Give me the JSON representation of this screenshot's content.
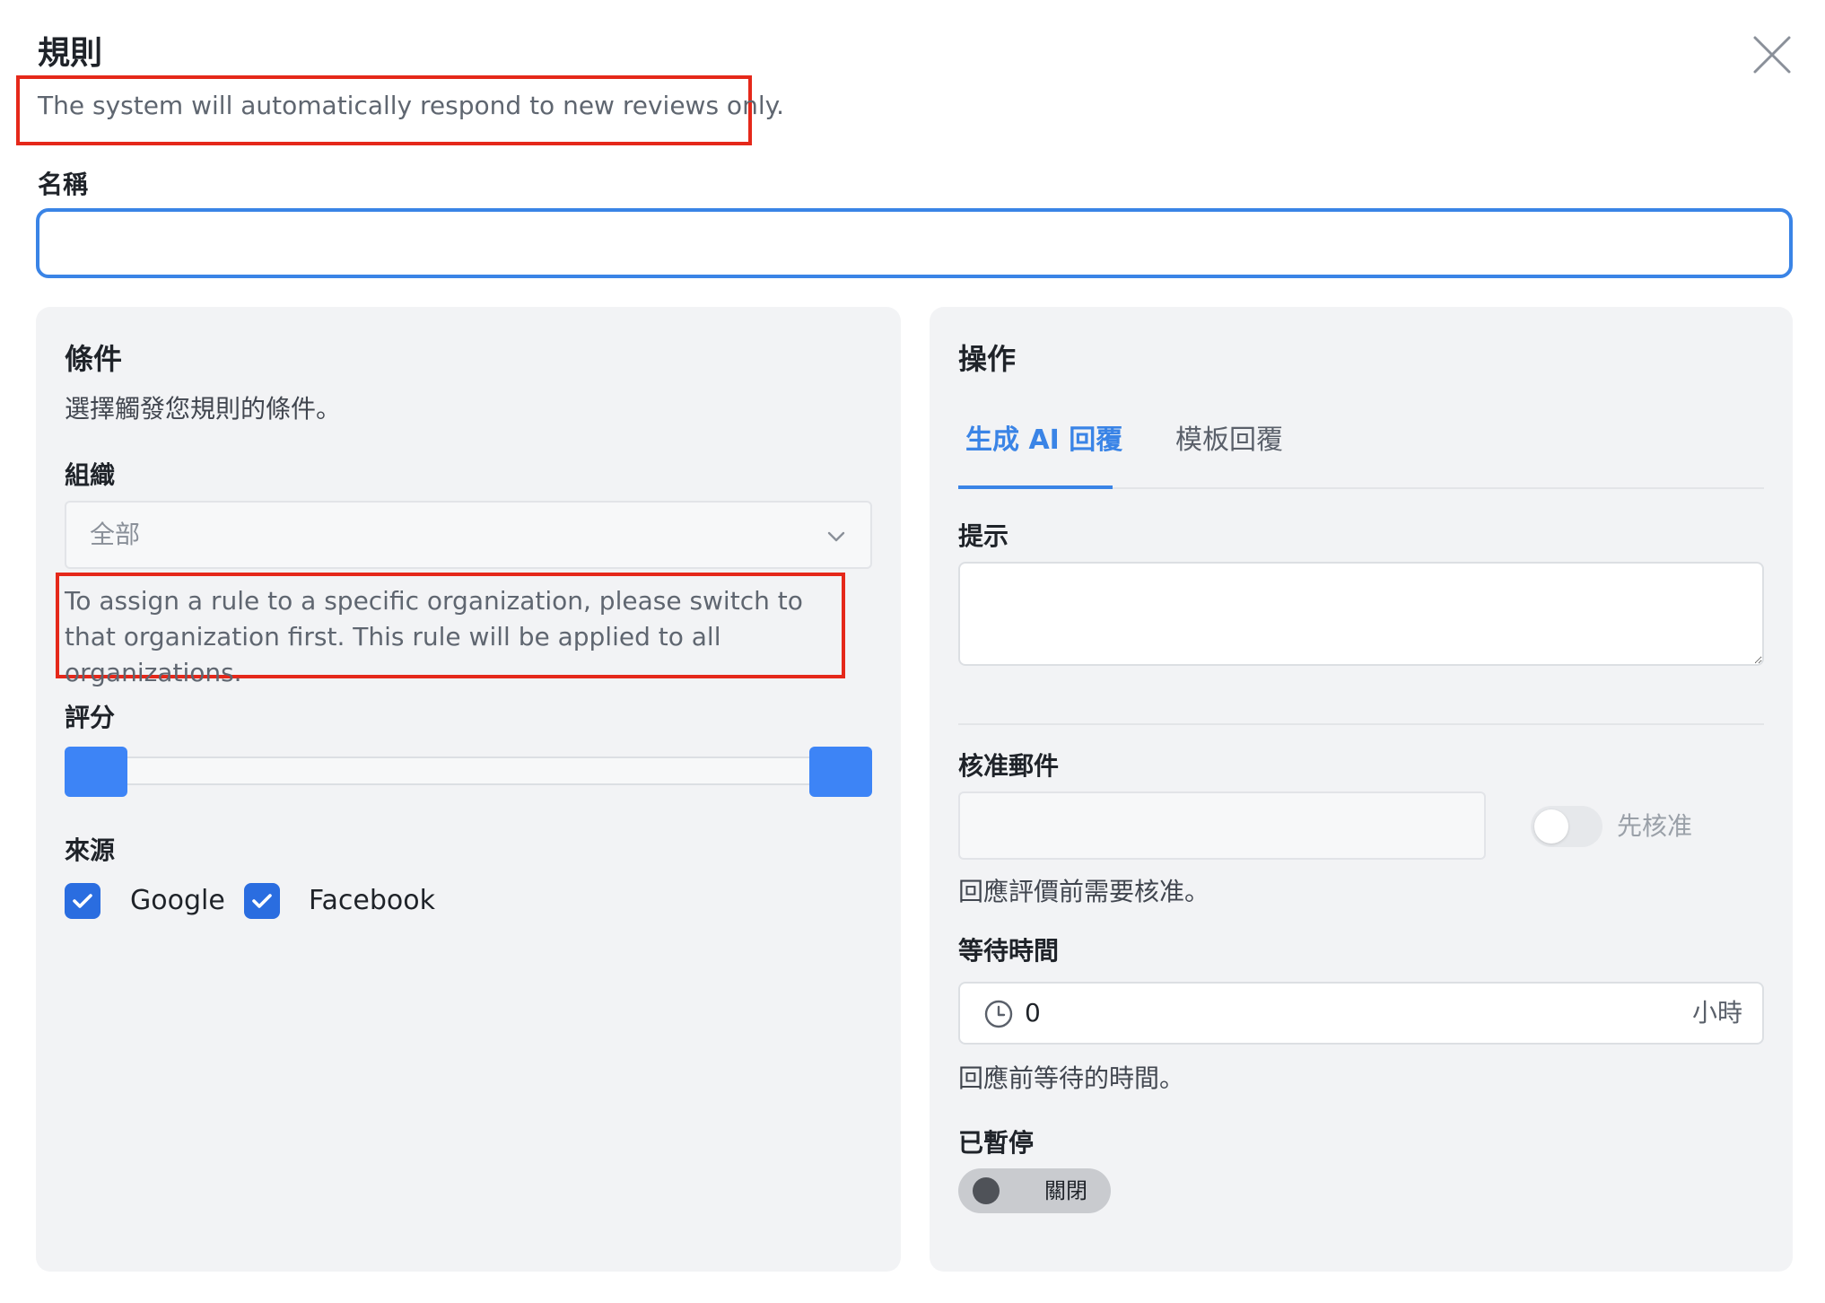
{
  "dialog": {
    "title": "規則",
    "subtitle": "The system will automatically respond to new reviews only."
  },
  "name_field": {
    "label": "名稱",
    "value": "",
    "placeholder": ""
  },
  "conditions": {
    "title": "條件",
    "description": "選擇觸發您規則的條件。",
    "organization": {
      "label": "組織",
      "selected": "全部",
      "note": "To assign a rule to a specific organization, please switch to that organization first. This rule will be applied to all organizations."
    },
    "rating": {
      "label": "評分"
    },
    "source": {
      "label": "來源",
      "options": [
        {
          "label": "Google",
          "checked": true
        },
        {
          "label": "Facebook",
          "checked": true
        }
      ]
    }
  },
  "actions": {
    "title": "操作",
    "tabs": [
      {
        "label": "生成 AI 回覆",
        "active": true
      },
      {
        "label": "模板回覆",
        "active": false
      }
    ],
    "prompt": {
      "label": "提示",
      "value": ""
    },
    "approval_email": {
      "label": "核准郵件",
      "value": "",
      "toggle_label": "先核准",
      "toggle_on": false,
      "help": "回應評價前需要核准。"
    },
    "wait_time": {
      "label": "等待時間",
      "value": "0",
      "unit": "小時",
      "help": "回應前等待的時間。"
    },
    "paused": {
      "label": "已暫停",
      "state_label": "關閉",
      "on": false
    }
  },
  "colors": {
    "accent": "#3a84e6",
    "checkbox": "#2a6de0",
    "slider": "#3d84f6",
    "annotation_border": "#e5281a",
    "panel_bg": "#f2f3f5"
  }
}
